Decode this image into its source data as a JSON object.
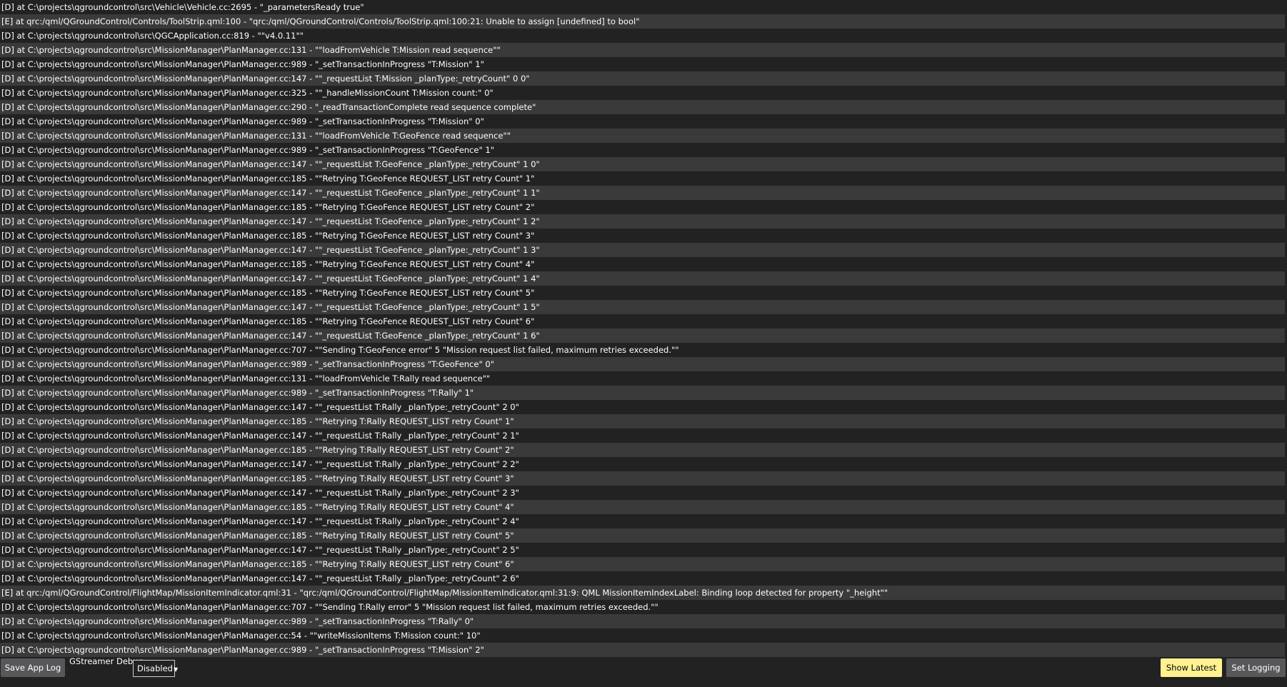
{
  "log": {
    "lines": [
      "[D] at C:\\projects\\qgroundcontrol\\src\\Vehicle\\Vehicle.cc:2695 - \"_parametersReady true\"",
      "[E] at qrc:/qml/QGroundControl/Controls/ToolStrip.qml:100 - \"qrc:/qml/QGroundControl/Controls/ToolStrip.qml:100:21: Unable to assign [undefined] to bool\"",
      "[D] at C:\\projects\\qgroundcontrol\\src\\QGCApplication.cc:819 - \"\"v4.0.11\"\"",
      "[D] at C:\\projects\\qgroundcontrol\\src\\MissionManager\\PlanManager.cc:131 - \"\"loadFromVehicle T:Mission read sequence\"\"",
      "[D] at C:\\projects\\qgroundcontrol\\src\\MissionManager\\PlanManager.cc:989 - \"_setTransactionInProgress \"T:Mission\" 1\"",
      "[D] at C:\\projects\\qgroundcontrol\\src\\MissionManager\\PlanManager.cc:147 - \"\"_requestList T:Mission _planType:_retryCount\" 0 0\"",
      "[D] at C:\\projects\\qgroundcontrol\\src\\MissionManager\\PlanManager.cc:325 - \"\"_handleMissionCount T:Mission count:\" 0\"",
      "[D] at C:\\projects\\qgroundcontrol\\src\\MissionManager\\PlanManager.cc:290 - \"_readTransactionComplete read sequence complete\"",
      "[D] at C:\\projects\\qgroundcontrol\\src\\MissionManager\\PlanManager.cc:989 - \"_setTransactionInProgress \"T:Mission\" 0\"",
      "[D] at C:\\projects\\qgroundcontrol\\src\\MissionManager\\PlanManager.cc:131 - \"\"loadFromVehicle T:GeoFence read sequence\"\"",
      "[D] at C:\\projects\\qgroundcontrol\\src\\MissionManager\\PlanManager.cc:989 - \"_setTransactionInProgress \"T:GeoFence\" 1\"",
      "[D] at C:\\projects\\qgroundcontrol\\src\\MissionManager\\PlanManager.cc:147 - \"\"_requestList T:GeoFence _planType:_retryCount\" 1 0\"",
      "[D] at C:\\projects\\qgroundcontrol\\src\\MissionManager\\PlanManager.cc:185 - \"\"Retrying T:GeoFence REQUEST_LIST retry Count\" 1\"",
      "[D] at C:\\projects\\qgroundcontrol\\src\\MissionManager\\PlanManager.cc:147 - \"\"_requestList T:GeoFence _planType:_retryCount\" 1 1\"",
      "[D] at C:\\projects\\qgroundcontrol\\src\\MissionManager\\PlanManager.cc:185 - \"\"Retrying T:GeoFence REQUEST_LIST retry Count\" 2\"",
      "[D] at C:\\projects\\qgroundcontrol\\src\\MissionManager\\PlanManager.cc:147 - \"\"_requestList T:GeoFence _planType:_retryCount\" 1 2\"",
      "[D] at C:\\projects\\qgroundcontrol\\src\\MissionManager\\PlanManager.cc:185 - \"\"Retrying T:GeoFence REQUEST_LIST retry Count\" 3\"",
      "[D] at C:\\projects\\qgroundcontrol\\src\\MissionManager\\PlanManager.cc:147 - \"\"_requestList T:GeoFence _planType:_retryCount\" 1 3\"",
      "[D] at C:\\projects\\qgroundcontrol\\src\\MissionManager\\PlanManager.cc:185 - \"\"Retrying T:GeoFence REQUEST_LIST retry Count\" 4\"",
      "[D] at C:\\projects\\qgroundcontrol\\src\\MissionManager\\PlanManager.cc:147 - \"\"_requestList T:GeoFence _planType:_retryCount\" 1 4\"",
      "[D] at C:\\projects\\qgroundcontrol\\src\\MissionManager\\PlanManager.cc:185 - \"\"Retrying T:GeoFence REQUEST_LIST retry Count\" 5\"",
      "[D] at C:\\projects\\qgroundcontrol\\src\\MissionManager\\PlanManager.cc:147 - \"\"_requestList T:GeoFence _planType:_retryCount\" 1 5\"",
      "[D] at C:\\projects\\qgroundcontrol\\src\\MissionManager\\PlanManager.cc:185 - \"\"Retrying T:GeoFence REQUEST_LIST retry Count\" 6\"",
      "[D] at C:\\projects\\qgroundcontrol\\src\\MissionManager\\PlanManager.cc:147 - \"\"_requestList T:GeoFence _planType:_retryCount\" 1 6\"",
      "[D] at C:\\projects\\qgroundcontrol\\src\\MissionManager\\PlanManager.cc:707 - \"\"Sending T:GeoFence error\" 5 \"Mission request list failed, maximum retries exceeded.\"\"",
      "[D] at C:\\projects\\qgroundcontrol\\src\\MissionManager\\PlanManager.cc:989 - \"_setTransactionInProgress \"T:GeoFence\" 0\"",
      "[D] at C:\\projects\\qgroundcontrol\\src\\MissionManager\\PlanManager.cc:131 - \"\"loadFromVehicle T:Rally read sequence\"\"",
      "[D] at C:\\projects\\qgroundcontrol\\src\\MissionManager\\PlanManager.cc:989 - \"_setTransactionInProgress \"T:Rally\" 1\"",
      "[D] at C:\\projects\\qgroundcontrol\\src\\MissionManager\\PlanManager.cc:147 - \"\"_requestList T:Rally _planType:_retryCount\" 2 0\"",
      "[D] at C:\\projects\\qgroundcontrol\\src\\MissionManager\\PlanManager.cc:185 - \"\"Retrying T:Rally REQUEST_LIST retry Count\" 1\"",
      "[D] at C:\\projects\\qgroundcontrol\\src\\MissionManager\\PlanManager.cc:147 - \"\"_requestList T:Rally _planType:_retryCount\" 2 1\"",
      "[D] at C:\\projects\\qgroundcontrol\\src\\MissionManager\\PlanManager.cc:185 - \"\"Retrying T:Rally REQUEST_LIST retry Count\" 2\"",
      "[D] at C:\\projects\\qgroundcontrol\\src\\MissionManager\\PlanManager.cc:147 - \"\"_requestList T:Rally _planType:_retryCount\" 2 2\"",
      "[D] at C:\\projects\\qgroundcontrol\\src\\MissionManager\\PlanManager.cc:185 - \"\"Retrying T:Rally REQUEST_LIST retry Count\" 3\"",
      "[D] at C:\\projects\\qgroundcontrol\\src\\MissionManager\\PlanManager.cc:147 - \"\"_requestList T:Rally _planType:_retryCount\" 2 3\"",
      "[D] at C:\\projects\\qgroundcontrol\\src\\MissionManager\\PlanManager.cc:185 - \"\"Retrying T:Rally REQUEST_LIST retry Count\" 4\"",
      "[D] at C:\\projects\\qgroundcontrol\\src\\MissionManager\\PlanManager.cc:147 - \"\"_requestList T:Rally _planType:_retryCount\" 2 4\"",
      "[D] at C:\\projects\\qgroundcontrol\\src\\MissionManager\\PlanManager.cc:185 - \"\"Retrying T:Rally REQUEST_LIST retry Count\" 5\"",
      "[D] at C:\\projects\\qgroundcontrol\\src\\MissionManager\\PlanManager.cc:147 - \"\"_requestList T:Rally _planType:_retryCount\" 2 5\"",
      "[D] at C:\\projects\\qgroundcontrol\\src\\MissionManager\\PlanManager.cc:185 - \"\"Retrying T:Rally REQUEST_LIST retry Count\" 6\"",
      "[D] at C:\\projects\\qgroundcontrol\\src\\MissionManager\\PlanManager.cc:147 - \"\"_requestList T:Rally _planType:_retryCount\" 2 6\"",
      "[E] at qrc:/qml/QGroundControl/FlightMap/MissionItemIndicator.qml:31 - \"qrc:/qml/QGroundControl/FlightMap/MissionItemIndicator.qml:31:9: QML MissionItemIndexLabel: Binding loop detected for property \"_height\"\"",
      "[D] at C:\\projects\\qgroundcontrol\\src\\MissionManager\\PlanManager.cc:707 - \"\"Sending T:Rally error\" 5 \"Mission request list failed, maximum retries exceeded.\"\"",
      "[D] at C:\\projects\\qgroundcontrol\\src\\MissionManager\\PlanManager.cc:989 - \"_setTransactionInProgress \"T:Rally\" 0\"",
      "[D] at C:\\projects\\qgroundcontrol\\src\\MissionManager\\PlanManager.cc:54 - \"\"writeMissionItems T:Mission count:\" 10\"",
      "[D] at C:\\projects\\qgroundcontrol\\src\\MissionManager\\PlanManager.cc:989 - \"_setTransactionInProgress \"T:Mission\" 2\""
    ]
  },
  "toolbar": {
    "save_app_log_label": "Save App Log",
    "gstreamer_debug_label": "GStreamer Debug",
    "gstreamer_debug_value": "Disabled",
    "show_latest_label": "Show Latest",
    "set_logging_label": "Set Logging"
  },
  "colors": {
    "background": "#222222",
    "row_alt": "#3a3a3a",
    "button_gray": "#58585a",
    "button_highlight": "#fff291"
  }
}
